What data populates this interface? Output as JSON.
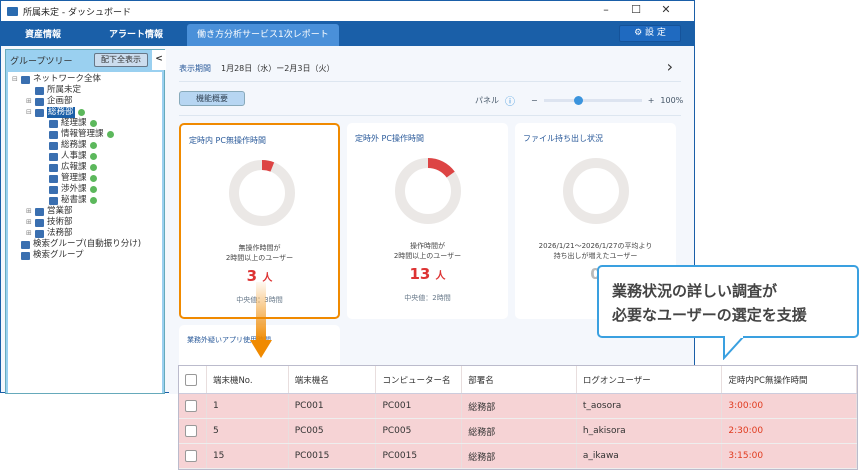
{
  "window": {
    "title": "所属未定 - ダッシュボード",
    "minimize": "–",
    "maximize": "☐",
    "close": "✕"
  },
  "tabs": [
    {
      "label": "資産情報"
    },
    {
      "label": "アラート情報"
    },
    {
      "label": "働き方分析サービス1次レポート"
    }
  ],
  "settings_label": "設 定",
  "sidebar": {
    "title": "グループツリー",
    "show_all": "配下全表示",
    "collapse": "<",
    "nodes": [
      {
        "label": "ネットワーク全体",
        "pm": "⊟",
        "level": 0
      },
      {
        "label": "所属未定",
        "pm": "",
        "level": 1
      },
      {
        "label": "企画部",
        "pm": "⊞",
        "level": 1
      },
      {
        "label": "総務部",
        "pm": "⊟",
        "level": 1,
        "ok": true,
        "selected": true
      },
      {
        "label": "経理課",
        "level": 2,
        "ok": true
      },
      {
        "label": "情報管理課",
        "level": 2,
        "ok": true
      },
      {
        "label": "総務課",
        "level": 2,
        "ok": true
      },
      {
        "label": "人事課",
        "level": 2,
        "ok": true
      },
      {
        "label": "広報課",
        "level": 2,
        "ok": true
      },
      {
        "label": "管理課",
        "level": 2,
        "ok": true
      },
      {
        "label": "渉外課",
        "level": 2,
        "ok": true
      },
      {
        "label": "秘書課",
        "level": 2,
        "ok": true
      },
      {
        "label": "営業部",
        "pm": "⊞",
        "level": 1
      },
      {
        "label": "技術部",
        "pm": "⊞",
        "level": 1
      },
      {
        "label": "法務部",
        "pm": "⊞",
        "level": 1
      },
      {
        "label": "検索グループ(自動振り分け)",
        "level": 0
      },
      {
        "label": "検索グループ",
        "level": 0
      }
    ]
  },
  "period": {
    "label": "表示期間",
    "value": "1月28日（水）ー2月3日（火）",
    "next": "›"
  },
  "feature_button": "機能概要",
  "panel": {
    "label": "パネル",
    "info": "ⓘ",
    "minus": "−",
    "plus": "+",
    "zoom": "100%",
    "slider_fraction": 0.35
  },
  "cards": [
    {
      "title": "定時内 PC無操作時間",
      "desc1": "無操作時間が",
      "desc2": "2時間以上のユーザー",
      "count": "3",
      "unit": "人",
      "median": "中央値：3時間",
      "fraction": 0.06
    },
    {
      "title": "定時外 PC操作時間",
      "desc1": "操作時間が",
      "desc2": "2時間以上のユーザー",
      "count": "13",
      "unit": "人",
      "median": "中央値：2時間",
      "fraction": 0.15
    },
    {
      "title": "ファイル持ち出し状況",
      "desc1": "2026/1/21〜2026/1/27の平均より",
      "desc2": "持ち出しが増えたユーザー",
      "count": "0",
      "unit": "",
      "median": "",
      "fraction": 0
    }
  ],
  "card4_title": "業務外疑いアプリ使用時間",
  "callout": {
    "line1": "業務状況の詳しい調査が",
    "line2": "必要なユーザーの選定を支援"
  },
  "table": {
    "headers": [
      "端末機No.",
      "端末機名",
      "コンピューター名",
      "部署名",
      "ログオンユーザー",
      "定時内PC無操作時間"
    ],
    "rows": [
      [
        "1",
        "PC001",
        "PC001",
        "総務部",
        "t_aosora",
        "3:00:00"
      ],
      [
        "5",
        "PC005",
        "PC005",
        "総務部",
        "h_akisora",
        "2:30:00"
      ],
      [
        "15",
        "PC0015",
        "PC0015",
        "総務部",
        "a_ikawa",
        "3:15:00"
      ]
    ]
  },
  "colors": {
    "accent": "#1a5fa8",
    "highlight": "#f08a00",
    "alert": "#d33",
    "row": "#f6d3d5"
  }
}
